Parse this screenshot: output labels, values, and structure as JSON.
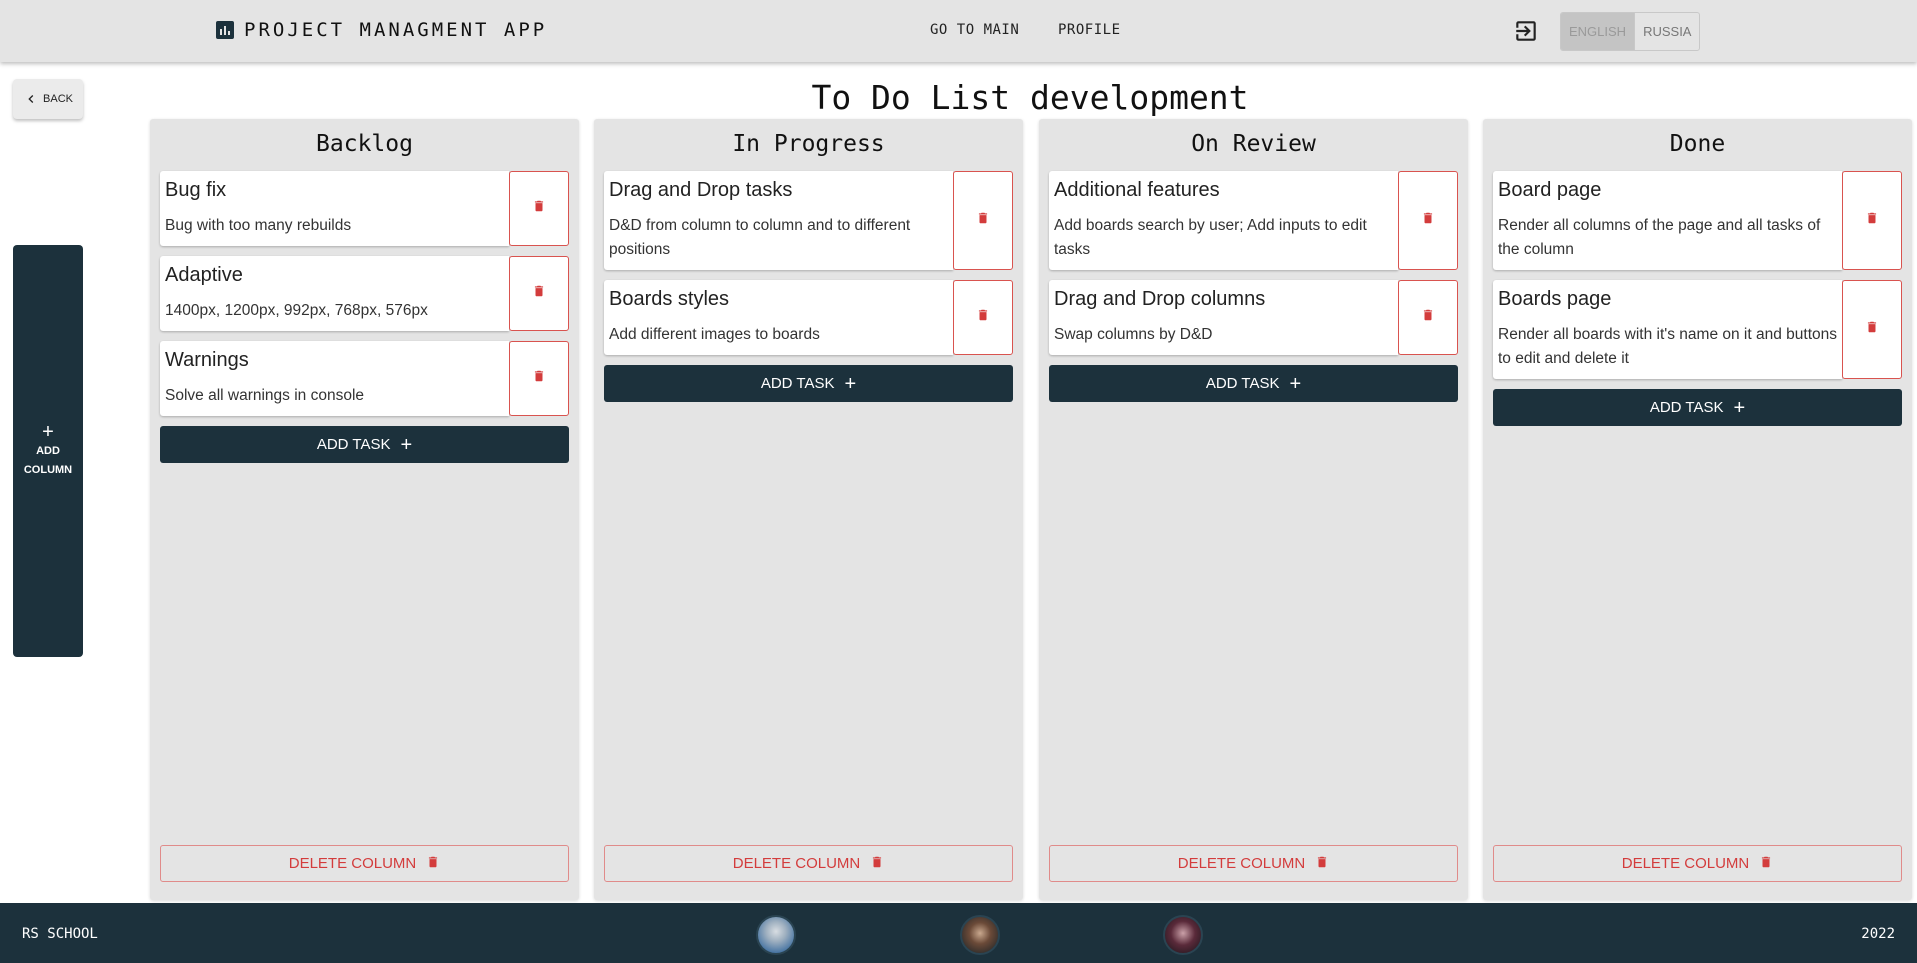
{
  "header": {
    "app_title": "PROJECT MANAGMENT APP",
    "nav_main": "GO TO MAIN",
    "nav_profile": "PROFILE",
    "lang_english": "ENGLISH",
    "lang_russia": "RUSSIA",
    "active_lang": "ENGLISH"
  },
  "back_label": "BACK",
  "board_title": "To Do List development",
  "add_column": {
    "line1": "ADD",
    "line2": "COLUMN"
  },
  "add_task_label": "ADD TASK",
  "delete_column_label": "DELETE COLUMN",
  "columns": [
    {
      "title": "Backlog",
      "tasks": [
        {
          "title": "Bug fix",
          "description": "Bug with too many rebuilds"
        },
        {
          "title": "Adaptive",
          "description": "1400px, 1200px, 992px, 768px, 576px"
        },
        {
          "title": "Warnings",
          "description": "Solve all warnings in console"
        }
      ]
    },
    {
      "title": "In Progress",
      "tasks": [
        {
          "title": "Drag and Drop tasks",
          "description": "D&D from column to column and to different positions"
        },
        {
          "title": "Boards styles",
          "description": "Add different images to boards"
        }
      ]
    },
    {
      "title": "On Review",
      "tasks": [
        {
          "title": "Additional features",
          "description": "Add boards search by user; Add inputs to edit tasks"
        },
        {
          "title": "Drag and Drop columns",
          "description": "Swap columns by D&D"
        }
      ]
    },
    {
      "title": "Done",
      "tasks": [
        {
          "title": "Board page",
          "description": "Render all columns of the page and all tasks of the column"
        },
        {
          "title": "Boards page",
          "description": "Render all boards with it's name on it and buttons to edit and delete it"
        }
      ]
    }
  ],
  "footer": {
    "school": "RS SCHOOL",
    "year": "2022",
    "avatars": [
      "author-avatar-1",
      "author-avatar-2",
      "author-avatar-3"
    ]
  },
  "colors": {
    "primary": "#1c313c",
    "danger": "#d33c3c",
    "surface": "#e4e4e4"
  }
}
